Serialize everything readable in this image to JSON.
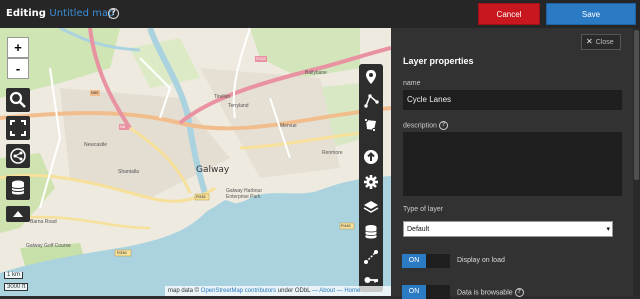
{
  "header": {
    "editing_label": "Editing",
    "map_name": "Untitled map",
    "help_icon": "question-circle-icon",
    "cancel_label": "Cancel",
    "save_label": "Save"
  },
  "map_controls": {
    "zoom_in": "+",
    "zoom_out": "-",
    "left_icons": [
      "search-icon",
      "fullscreen-icon",
      "share-icon",
      "layers-stack-icon",
      "collapse-up-icon"
    ],
    "right_icons": [
      "marker-icon",
      "polyline-icon",
      "polygon-icon",
      "upload-icon",
      "gear-icon",
      "layers-icon",
      "database-icon",
      "link-icon",
      "key-icon"
    ]
  },
  "map": {
    "city_label": "Galway",
    "place_labels": [
      "Tirellan",
      "Terryland",
      "Ballybane",
      "Mervue",
      "Shantalla",
      "Newcastle",
      "Renmore",
      "Galway Harbour Enterprise Park",
      "Galway Golf Course",
      "Barna Road"
    ],
    "road_shields": [
      "N6",
      "N59",
      "R336",
      "R338",
      "R336",
      "R446"
    ],
    "scale_km": "1 km",
    "scale_ft": "3000 ft",
    "attribution": {
      "prefix": "map data ©",
      "osm_link": "OpenStreetMap contributors",
      "license": "under ODbL",
      "about": "— About —",
      "home": "Home"
    }
  },
  "panel": {
    "close_label": "Close",
    "title": "Layer properties",
    "name_label": "name",
    "name_value": "Cycle Lanes",
    "description_label": "description",
    "type_label": "Type of layer",
    "type_value": "Default",
    "toggle_on_label": "ON",
    "display_on_load_label": "Display on load",
    "data_browsable_label": "Data is browsable"
  },
  "colors": {
    "cancel": "#c9171f",
    "save": "#2b7bc4",
    "accent_link": "#3a8dd6",
    "panel_bg": "#323232"
  }
}
